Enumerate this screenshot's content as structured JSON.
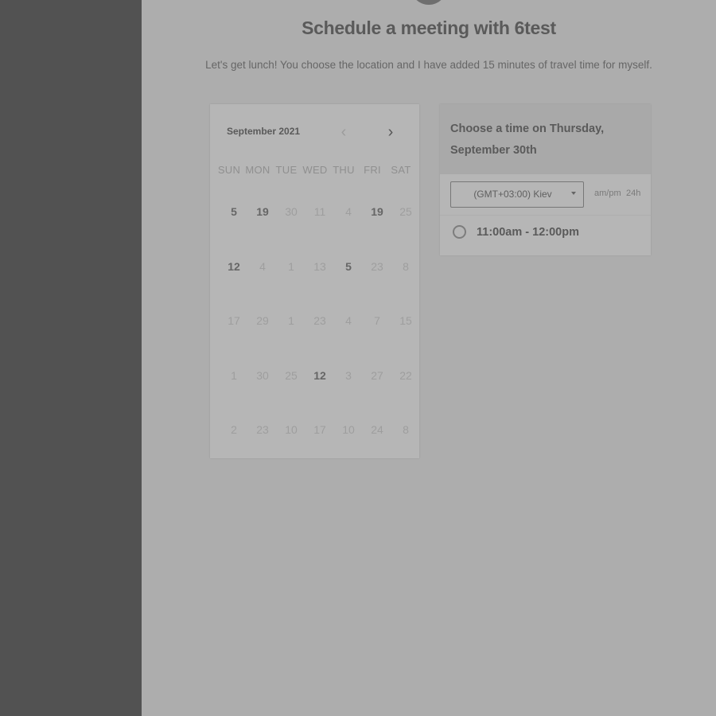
{
  "header": {
    "title": "Schedule a meeting with 6test",
    "subtitle": "Let's get lunch! You choose the location and I have added 15 minutes of travel time for myself."
  },
  "calendar": {
    "month": "September 2021",
    "prev_icon": "chevron-left-icon",
    "next_icon": "chevron-right-icon",
    "weekdays": [
      "SUN",
      "MON",
      "TUE",
      "WED",
      "THU",
      "FRI",
      "SAT"
    ],
    "weeks": [
      [
        "5",
        "19",
        "30",
        "11",
        "4",
        "19",
        "25"
      ],
      [
        "12",
        "4",
        "1",
        "13",
        "5",
        "23",
        "8"
      ],
      [
        "17",
        "29",
        "1",
        "23",
        "4",
        "7",
        "15"
      ],
      [
        "1",
        "30",
        "25",
        "12",
        "3",
        "27",
        "22"
      ],
      [
        "2",
        "23",
        "10",
        "17",
        "10",
        "24",
        "8"
      ]
    ],
    "bold_days": [
      [
        0,
        0
      ],
      [
        0,
        1
      ],
      [
        0,
        5
      ],
      [
        1,
        0
      ],
      [
        1,
        4
      ],
      [
        3,
        3
      ]
    ]
  },
  "time_panel": {
    "title": "Choose a time on Thursday, September 30th",
    "timezone": "(GMT+03:00) Kiev",
    "format_ampm": "am/pm",
    "format_24h": "24h",
    "slots": [
      "11:00am - 12:00pm"
    ]
  },
  "colors": {
    "sidebar": "#525252",
    "background": "#adadad",
    "panel": "#b6b6b6"
  }
}
